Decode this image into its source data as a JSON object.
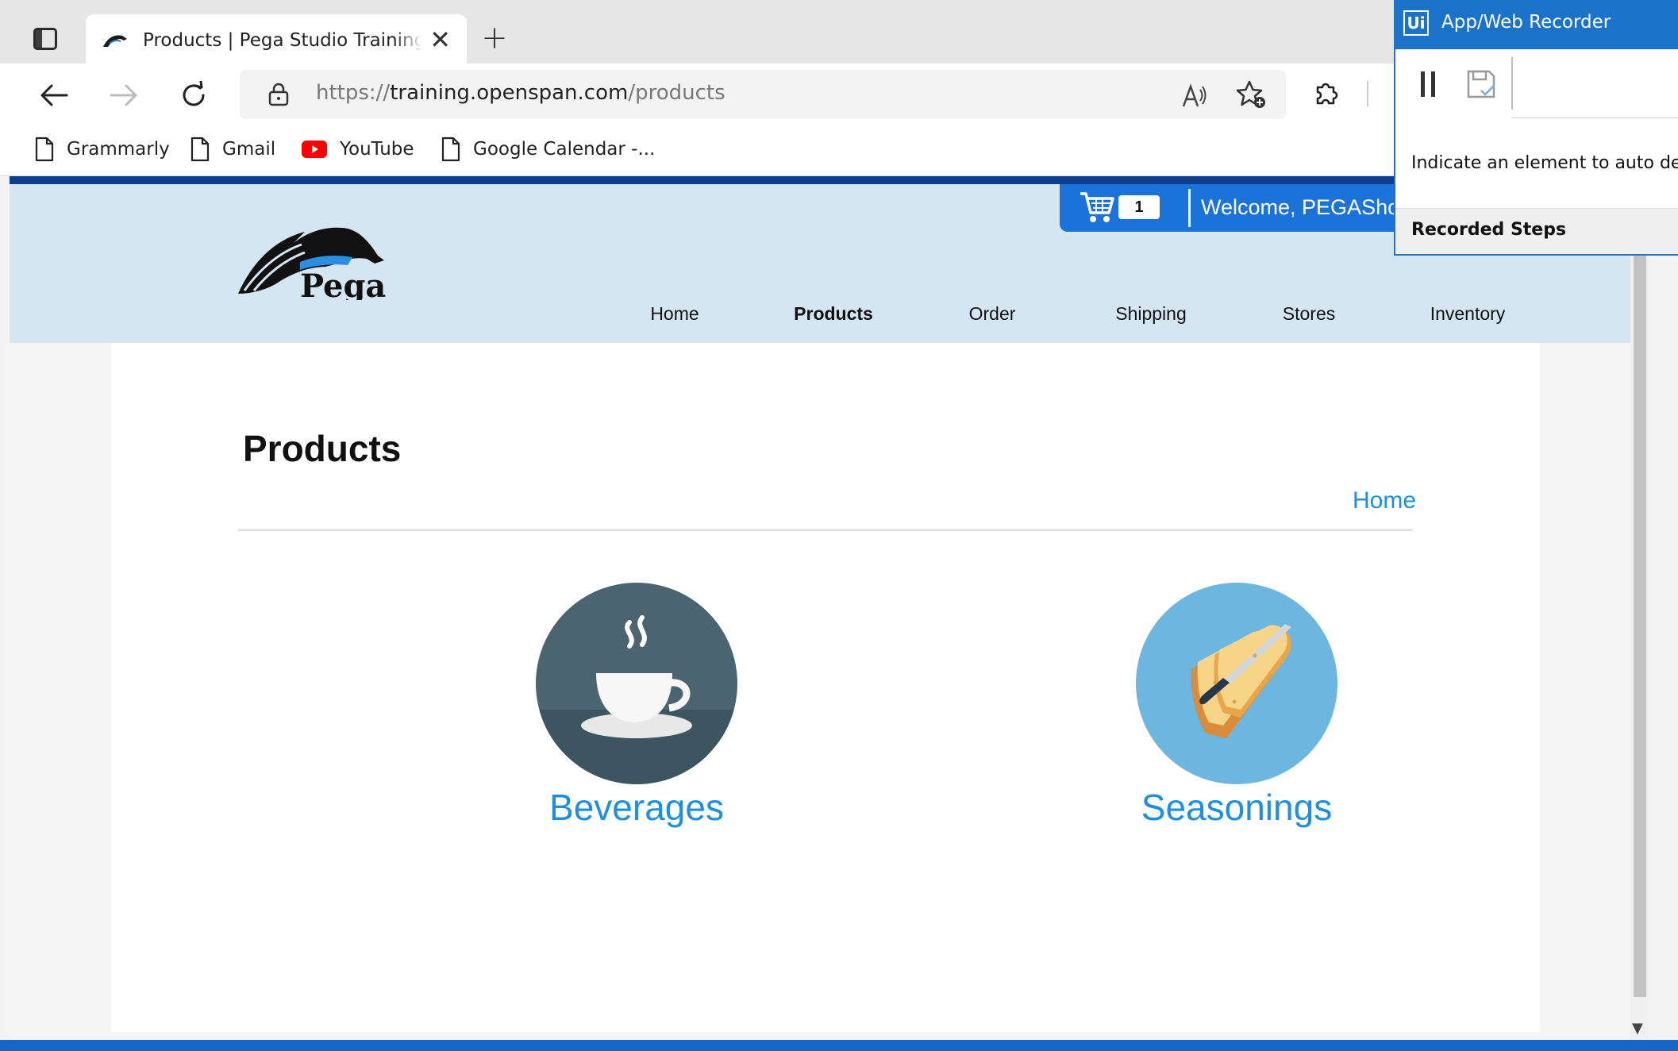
{
  "browser": {
    "tab_title": "Products | Pega Studio Training W",
    "new_tab_symbol": "+",
    "close_symbol": "✕",
    "url_scheme": "https://",
    "url_host": "training.openspan.com",
    "url_path": "/products",
    "read_aloud_label": "A)",
    "bookmarks": [
      {
        "label": "Grammarly",
        "icon": "page-icon"
      },
      {
        "label": "Gmail",
        "icon": "page-icon"
      },
      {
        "label": "YouTube",
        "icon": "youtube-icon"
      },
      {
        "label": "Google Calendar -...",
        "icon": "page-icon"
      }
    ]
  },
  "site": {
    "logo_text": "Pega",
    "cart_count": "1",
    "welcome": "Welcome, PEGAShopper",
    "nav": [
      "Home",
      "Products",
      "Order",
      "Shipping",
      "Stores",
      "Inventory"
    ],
    "active_nav": "Products",
    "page_title": "Products",
    "breadcrumb": "Home",
    "categories": [
      {
        "label": "Beverages",
        "icon": "coffee-cup-icon"
      },
      {
        "label": "Seasonings",
        "icon": "bread-knife-icon"
      }
    ]
  },
  "recorder": {
    "logo": "Ui",
    "title": "App/Web Recorder",
    "hint": "Indicate an element to auto detect",
    "steps_label": "Recorded Steps"
  },
  "colors": {
    "accent_blue": "#1b72d8",
    "link_blue": "#1e8fe0",
    "header_bg": "#d5e6f3"
  }
}
